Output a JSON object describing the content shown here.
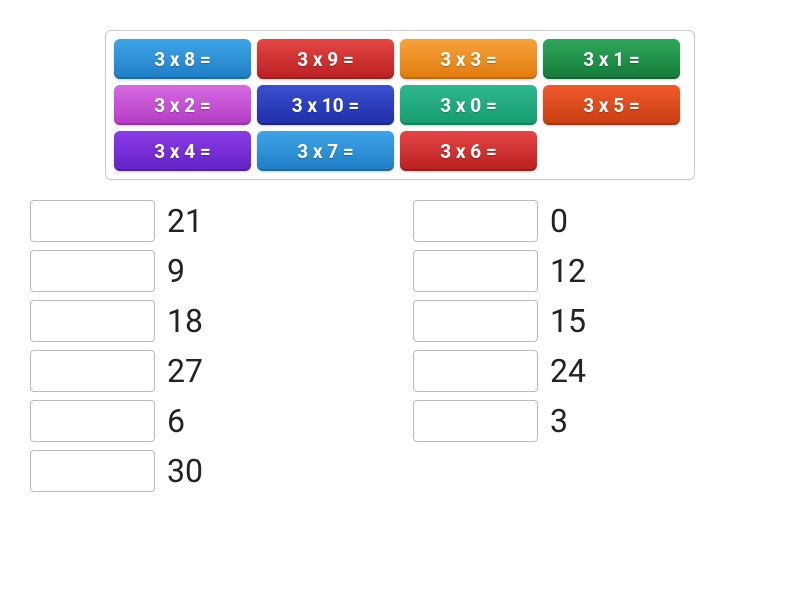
{
  "tiles": [
    {
      "label": "3 x 8 =",
      "bg": "linear-gradient(#3fa4e8, #1f7dc4)",
      "name": "tile-3x8"
    },
    {
      "label": "3 x 9 =",
      "bg": "linear-gradient(#e64545, #b82020)",
      "name": "tile-3x9"
    },
    {
      "label": "3 x 3 =",
      "bg": "linear-gradient(#f7a23c, #e07b0e)",
      "name": "tile-3x3"
    },
    {
      "label": "3 x 1 =",
      "bg": "linear-gradient(#2fa85b, #147a3a)",
      "name": "tile-3x1"
    },
    {
      "label": "3 x 2 =",
      "bg": "linear-gradient(#d66be0, #b33bc4)",
      "name": "tile-3x2"
    },
    {
      "label": "3 x 10 =",
      "bg": "linear-gradient(#3a4fd1, #1f2fa6)",
      "name": "tile-3x10"
    },
    {
      "label": "3 x 0 =",
      "bg": "linear-gradient(#2fb88f, #159b70)",
      "name": "tile-3x0"
    },
    {
      "label": "3 x 5 =",
      "bg": "linear-gradient(#f05a2a, #c73e10)",
      "name": "tile-3x5"
    },
    {
      "label": "3 x 4 =",
      "bg": "linear-gradient(#8a3ce6, #6322c4)",
      "name": "tile-3x4"
    },
    {
      "label": "3 x 7 =",
      "bg": "linear-gradient(#3fa4e8, #1f7dc4)",
      "name": "tile-3x7"
    },
    {
      "label": "3 x 6 =",
      "bg": "linear-gradient(#e64545, #b82020)",
      "name": "tile-3x6"
    }
  ],
  "answers_left": [
    {
      "value": "21"
    },
    {
      "value": "9"
    },
    {
      "value": "18"
    },
    {
      "value": "27"
    },
    {
      "value": "6"
    },
    {
      "value": "30"
    }
  ],
  "answers_right": [
    {
      "value": "0"
    },
    {
      "value": "12"
    },
    {
      "value": "15"
    },
    {
      "value": "24"
    },
    {
      "value": "3"
    }
  ]
}
